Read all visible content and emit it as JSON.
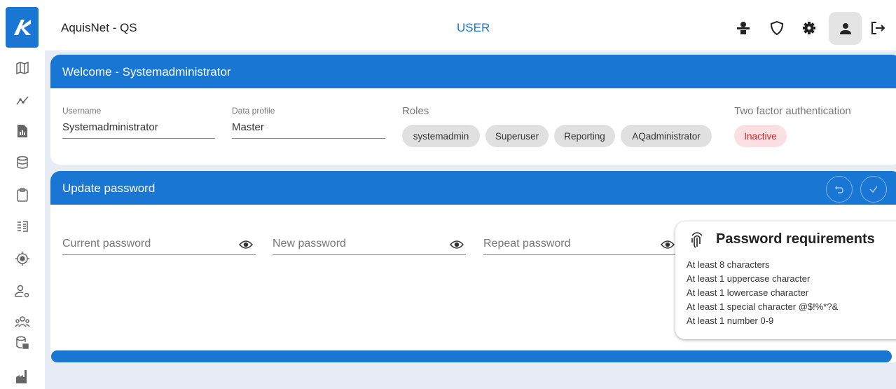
{
  "app": {
    "title": "AquisNet - QS",
    "section": "USER"
  },
  "sidebar": {
    "items": [
      {
        "icon": "map-icon"
      },
      {
        "icon": "chart-line-icon"
      },
      {
        "icon": "report-icon"
      },
      {
        "icon": "database-icon"
      },
      {
        "icon": "clipboard-icon"
      },
      {
        "icon": "list-icon"
      },
      {
        "icon": "target-icon"
      },
      {
        "icon": "user-settings-icon"
      },
      {
        "icon": "users-group-icon"
      },
      {
        "icon": "database-lock-icon"
      },
      {
        "icon": "factory-icon"
      }
    ]
  },
  "topbar": {
    "icons": [
      "network-icon",
      "shield-icon",
      "gear-icon",
      "user-icon",
      "logout-icon"
    ]
  },
  "welcome": {
    "title": "Welcome - Systemadministrator",
    "username_label": "Username",
    "username": "Systemadministrator",
    "data_profile_label": "Data profile",
    "data_profile": "Master",
    "roles_label": "Roles",
    "roles": [
      "systemadmin",
      "Superuser",
      "Reporting",
      "AQadministrator"
    ],
    "twofa_label": "Two factor authentication",
    "twofa_status": "Inactive"
  },
  "password": {
    "title": "Update password",
    "current_placeholder": "Current password",
    "new_placeholder": "New password",
    "repeat_placeholder": "Repeat password"
  },
  "requirements": {
    "title": "Password requirements",
    "items": [
      "At least 8 characters",
      "At least 1 uppercase character",
      "At least 1 lowercase character",
      "At least 1 special character @$!%*?&",
      "At least 1 number 0-9"
    ]
  },
  "colors": {
    "primary": "#1976d2",
    "background": "#e8ecf4",
    "inactive_bg": "#fbe0e3",
    "inactive_text": "#c62828"
  }
}
